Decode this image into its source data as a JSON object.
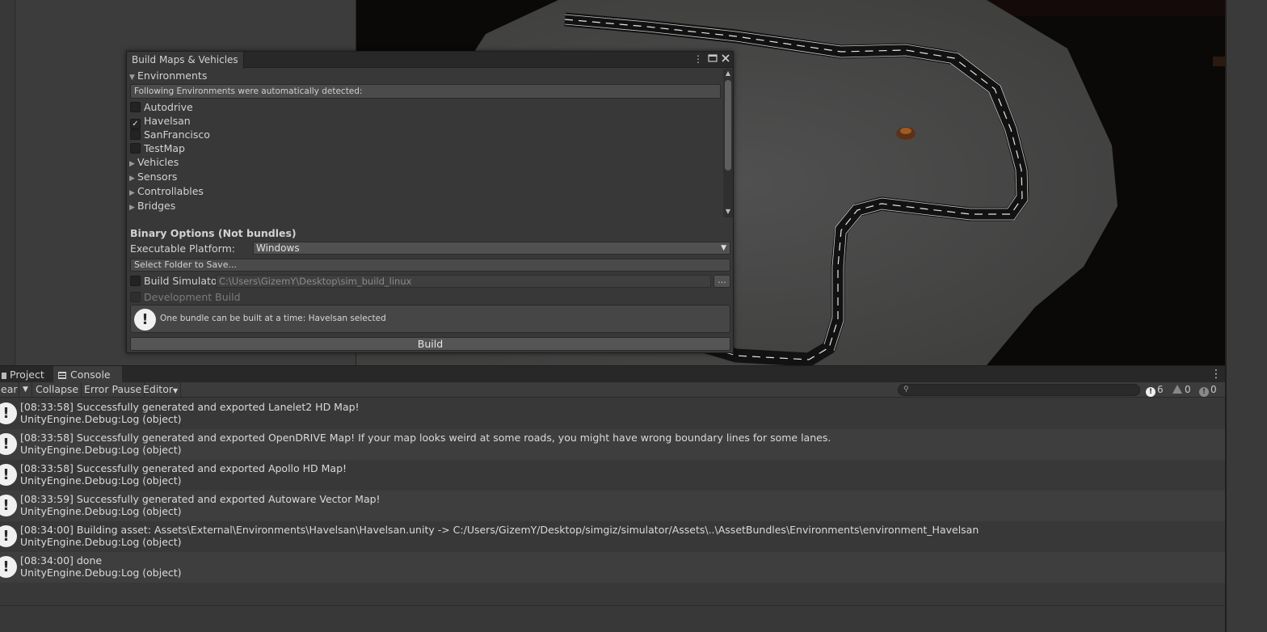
{
  "build_window": {
    "title": "Build Maps & Vehicles",
    "environments_label": "Environments",
    "detected_help": "Following Environments were automatically detected:",
    "environments": [
      {
        "name": "Autodrive",
        "checked": false
      },
      {
        "name": "Havelsan",
        "checked": true
      },
      {
        "name": "SanFrancisco",
        "checked": false
      },
      {
        "name": "TestMap",
        "checked": false
      }
    ],
    "foldouts": [
      "Vehicles",
      "Sensors",
      "Controllables",
      "Bridges"
    ],
    "binary_options_label": "Binary Options (Not bundles)",
    "executable_platform_label": "Executable Platform:",
    "executable_platform_value": "Windows",
    "select_folder_label": "Select Folder to Save...",
    "build_simulator_label": "Build Simulator:",
    "build_simulator_path": "C:\\Users\\GizemY\\Desktop\\sim_build_linux",
    "browse_label": "...",
    "development_build_label": "Development Build",
    "help_message": "One bundle can be built at a time: Havelsan selected",
    "build_label": "Build"
  },
  "console": {
    "tabs": {
      "project": "Project",
      "console": "Console"
    },
    "toolbar": {
      "clear": "ear",
      "collapse": "Collapse",
      "error_pause": "Error Pause",
      "editor": "Editor"
    },
    "counts": {
      "info": "6",
      "warning": "0",
      "error": "0"
    },
    "logs": [
      {
        "line1": "[08:33:58] Successfully generated and exported Lanelet2 HD Map!",
        "line2": "UnityEngine.Debug:Log (object)"
      },
      {
        "line1": "[08:33:58] Successfully generated and exported OpenDRIVE Map! If your map looks weird at some roads, you might have wrong boundary lines for some lanes.",
        "line2": "UnityEngine.Debug:Log (object)"
      },
      {
        "line1": "[08:33:58] Successfully generated and exported Apollo HD Map!",
        "line2": "UnityEngine.Debug:Log (object)"
      },
      {
        "line1": "[08:33:59] Successfully generated and exported Autoware Vector Map!",
        "line2": "UnityEngine.Debug:Log (object)"
      },
      {
        "line1": "[08:34:00] Building asset: Assets\\External\\Environments\\Havelsan\\Havelsan.unity -> C:/Users/GizemY/Desktop/simgiz/simulator/Assets\\..\\AssetBundles\\Environments\\environment_Havelsan",
        "line2": "UnityEngine.Debug:Log (object)"
      },
      {
        "line1": "[08:34:00] done",
        "line2": "UnityEngine.Debug:Log (object)"
      }
    ]
  },
  "icons": {
    "info": "exclamation-circle-icon",
    "warning": "warning-triangle-icon",
    "error": "error-circle-icon",
    "search": "search-icon",
    "menu": "kebab-menu-icon"
  },
  "colors": {
    "panel": "#383838",
    "scene_background": "#0b0808",
    "ground": "#4a4a48",
    "road": "#141414"
  }
}
